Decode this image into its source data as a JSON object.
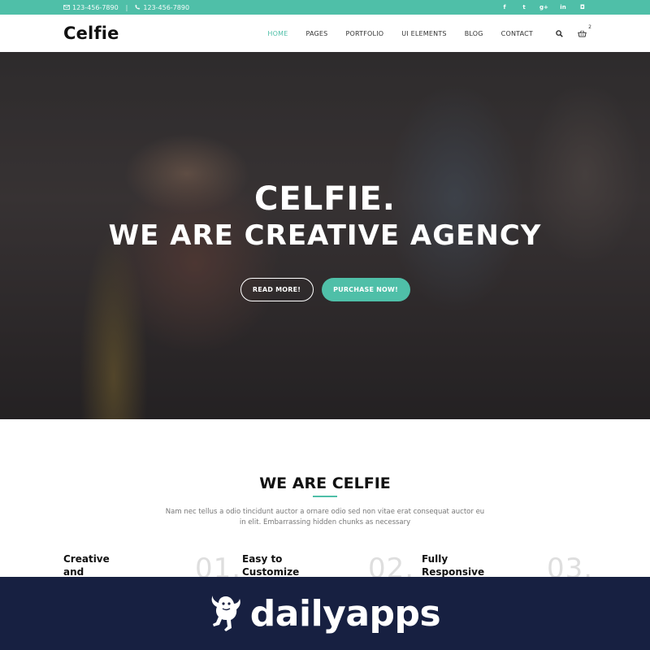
{
  "topbar": {
    "email": "123-456-7890",
    "phone": "123-456-7890",
    "separator": "|",
    "social": [
      {
        "icon": "facebook-icon",
        "glyph": "f"
      },
      {
        "icon": "twitter-icon",
        "glyph": "t"
      },
      {
        "icon": "google-plus-icon",
        "glyph": "g+"
      },
      {
        "icon": "linkedin-icon",
        "glyph": "in"
      },
      {
        "icon": "instagram-icon",
        "glyph": "◘"
      }
    ]
  },
  "nav": {
    "logo": "Celfie",
    "items": [
      "HOME",
      "PAGES",
      "PORTFOLIO",
      "UI ELEMENTS",
      "BLOG",
      "CONTACT"
    ],
    "active": "HOME",
    "cart_count": "2",
    "accent": "#4fbfa8"
  },
  "hero": {
    "title_line1": "CELFIE.",
    "title_line2": "WE ARE CREATIVE AGENCY",
    "read_more": "READ MORE!",
    "purchase": "PURCHASE NOW!"
  },
  "about": {
    "title": "WE ARE CELFIE",
    "text": "Nam nec tellus a odio tincidunt auctor a ornare odio sed non vitae erat consequat auctor eu in elit. Embarrassing hidden chunks as necessary"
  },
  "features": [
    {
      "title": "Creative and Modern",
      "number": "01."
    },
    {
      "title": "Easy to Customize",
      "number": "02."
    },
    {
      "title": "Fully Responsive",
      "number": "03."
    }
  ],
  "banner": {
    "text": "dailyapps",
    "background": "#172041"
  }
}
